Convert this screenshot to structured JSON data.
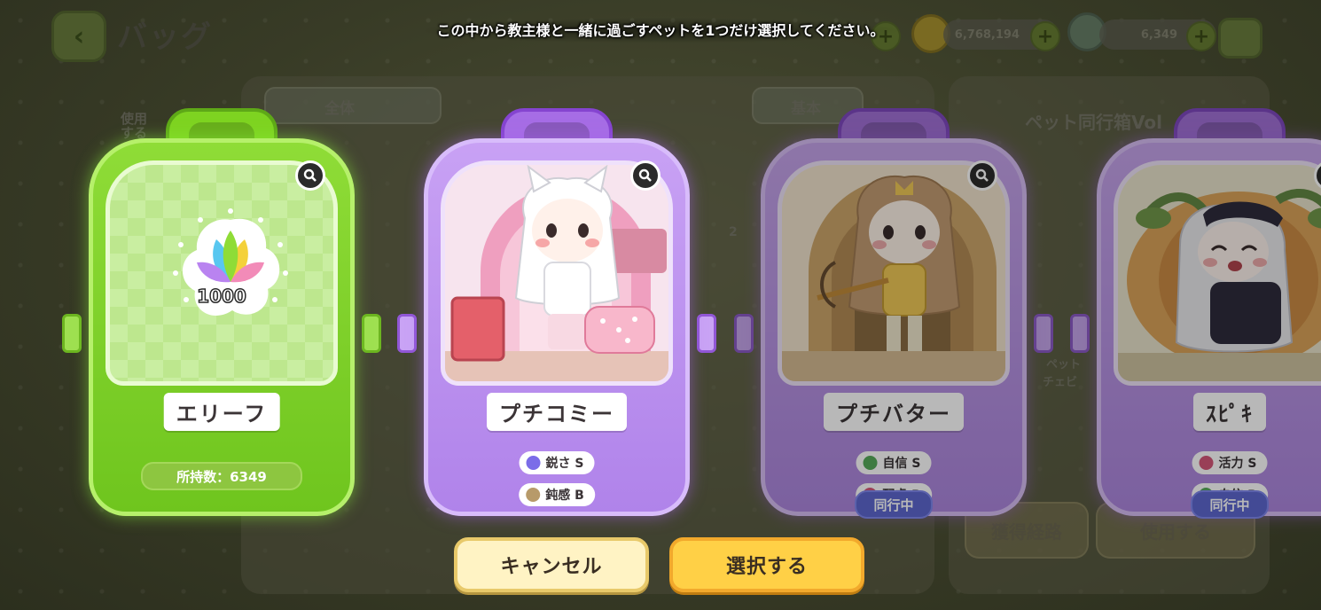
{
  "header": {
    "back_icon": "chevron-left-icon",
    "title": "バッグ",
    "instruction": "この中から教主様と一緒に過ごすペットを1つだけ選択してください。",
    "resources": [
      {
        "icon": "gold-coin-icon",
        "value": "6,768,194"
      },
      {
        "icon": "leaf-crystal-icon",
        "value": "6,349"
      }
    ],
    "home_icon": "home-icon"
  },
  "background": {
    "filter_all": "全体",
    "sort_basic": "基本",
    "use_label": "使用する",
    "detail_title": "ペット同行箱Vol",
    "item_count": "2",
    "side_text": [
      "ペット",
      "チェビ"
    ],
    "acquire_button": "獲得経路",
    "use_button": "使用する"
  },
  "cards": [
    {
      "name": "エリーフ",
      "variant": "green",
      "reward_amount": "1000",
      "owned_label": "所持数：6349",
      "stats": [],
      "accompanying": false
    },
    {
      "name": "プチコミー",
      "variant": "purple",
      "stats": [
        {
          "label": "鋭さ S",
          "icon_color": "#7b6ce8"
        },
        {
          "label": "鈍感 B",
          "icon_color": "#b79a6a"
        }
      ],
      "accompanying": false
    },
    {
      "name": "プチバター",
      "variant": "purple",
      "stats": [
        {
          "label": "自信 S",
          "icon_color": "#4caf50"
        },
        {
          "label": "配慮 B",
          "icon_color": "#e5527a"
        }
      ],
      "accompanying": true,
      "accompanying_label": "同行中"
    },
    {
      "name": "ｽﾋﾟｷ",
      "variant": "purple",
      "stats": [
        {
          "label": "活力 S",
          "icon_color": "#e5527a"
        },
        {
          "label": "自信 B",
          "icon_color": "#4caf50"
        }
      ],
      "accompanying": true,
      "accompanying_label": "同行中"
    }
  ],
  "buttons": {
    "cancel": "キャンセル",
    "select": "選択する"
  },
  "colors": {
    "green_card": "#7ed321",
    "purple_card": "#b083ea",
    "select_button": "#ffd046",
    "cancel_button": "#fff3c4",
    "accompany_badge": "#5a66e0"
  }
}
